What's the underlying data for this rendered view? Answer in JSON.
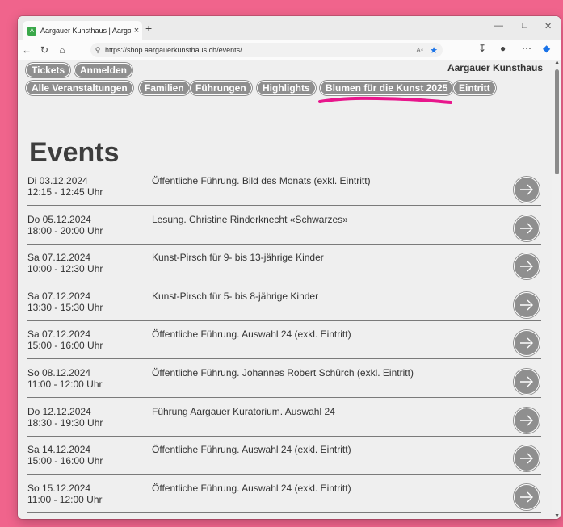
{
  "browser": {
    "tab_title": "Aargauer Kunsthaus | Aargauer K...",
    "tab_close": "×",
    "new_tab": "+",
    "url": "https://shop.aargauerkunsthaus.ch/events/",
    "read_aloud": "A⁴",
    "colors": {
      "frame": "#f0648c",
      "accent": "#1a73e8"
    }
  },
  "site": {
    "top_nav": [
      "Tickets",
      "Anmelden"
    ],
    "brand": "Aargauer Kunsthaus",
    "category_nav": [
      "Alle Veranstaltungen",
      "Familien",
      "Führungen",
      "Highlights",
      "Blumen für die Kunst 2025",
      "Eintritt"
    ],
    "highlight_color": "#e8168c",
    "page_title": "Events"
  },
  "events": [
    {
      "day": "Di 03.12.2024",
      "time": "12:15 - 12:45 Uhr",
      "title": "Öffentliche Führung. Bild des Monats (exkl. Eintritt)"
    },
    {
      "day": "Do 05.12.2024",
      "time": "18:00 - 20:00 Uhr",
      "title": "Lesung. Christine Rinderknecht «Schwarzes»"
    },
    {
      "day": "Sa 07.12.2024",
      "time": "10:00 - 12:30 Uhr",
      "title": "Kunst-Pirsch für 9- bis 13-jährige Kinder"
    },
    {
      "day": "Sa 07.12.2024",
      "time": "13:30 - 15:30 Uhr",
      "title": "Kunst-Pirsch für 5- bis 8-jährige Kinder"
    },
    {
      "day": "Sa 07.12.2024",
      "time": "15:00 - 16:00 Uhr",
      "title": "Öffentliche Führung. Auswahl 24 (exkl. Eintritt)"
    },
    {
      "day": "So 08.12.2024",
      "time": "11:00 - 12:00 Uhr",
      "title": "Öffentliche Führung. Johannes Robert Schürch (exkl. Eintritt)"
    },
    {
      "day": "Do 12.12.2024",
      "time": "18:30 - 19:30 Uhr",
      "title": "Führung Aargauer Kuratorium. Auswahl 24"
    },
    {
      "day": "Sa 14.12.2024",
      "time": "15:00 - 16:00 Uhr",
      "title": "Öffentliche Führung. Auswahl 24 (exkl. Eintritt)"
    },
    {
      "day": "So 15.12.2024",
      "time": "11:00 - 12:00 Uhr",
      "title": "Öffentliche Führung. Auswahl 24 (exkl. Eintritt)"
    }
  ]
}
